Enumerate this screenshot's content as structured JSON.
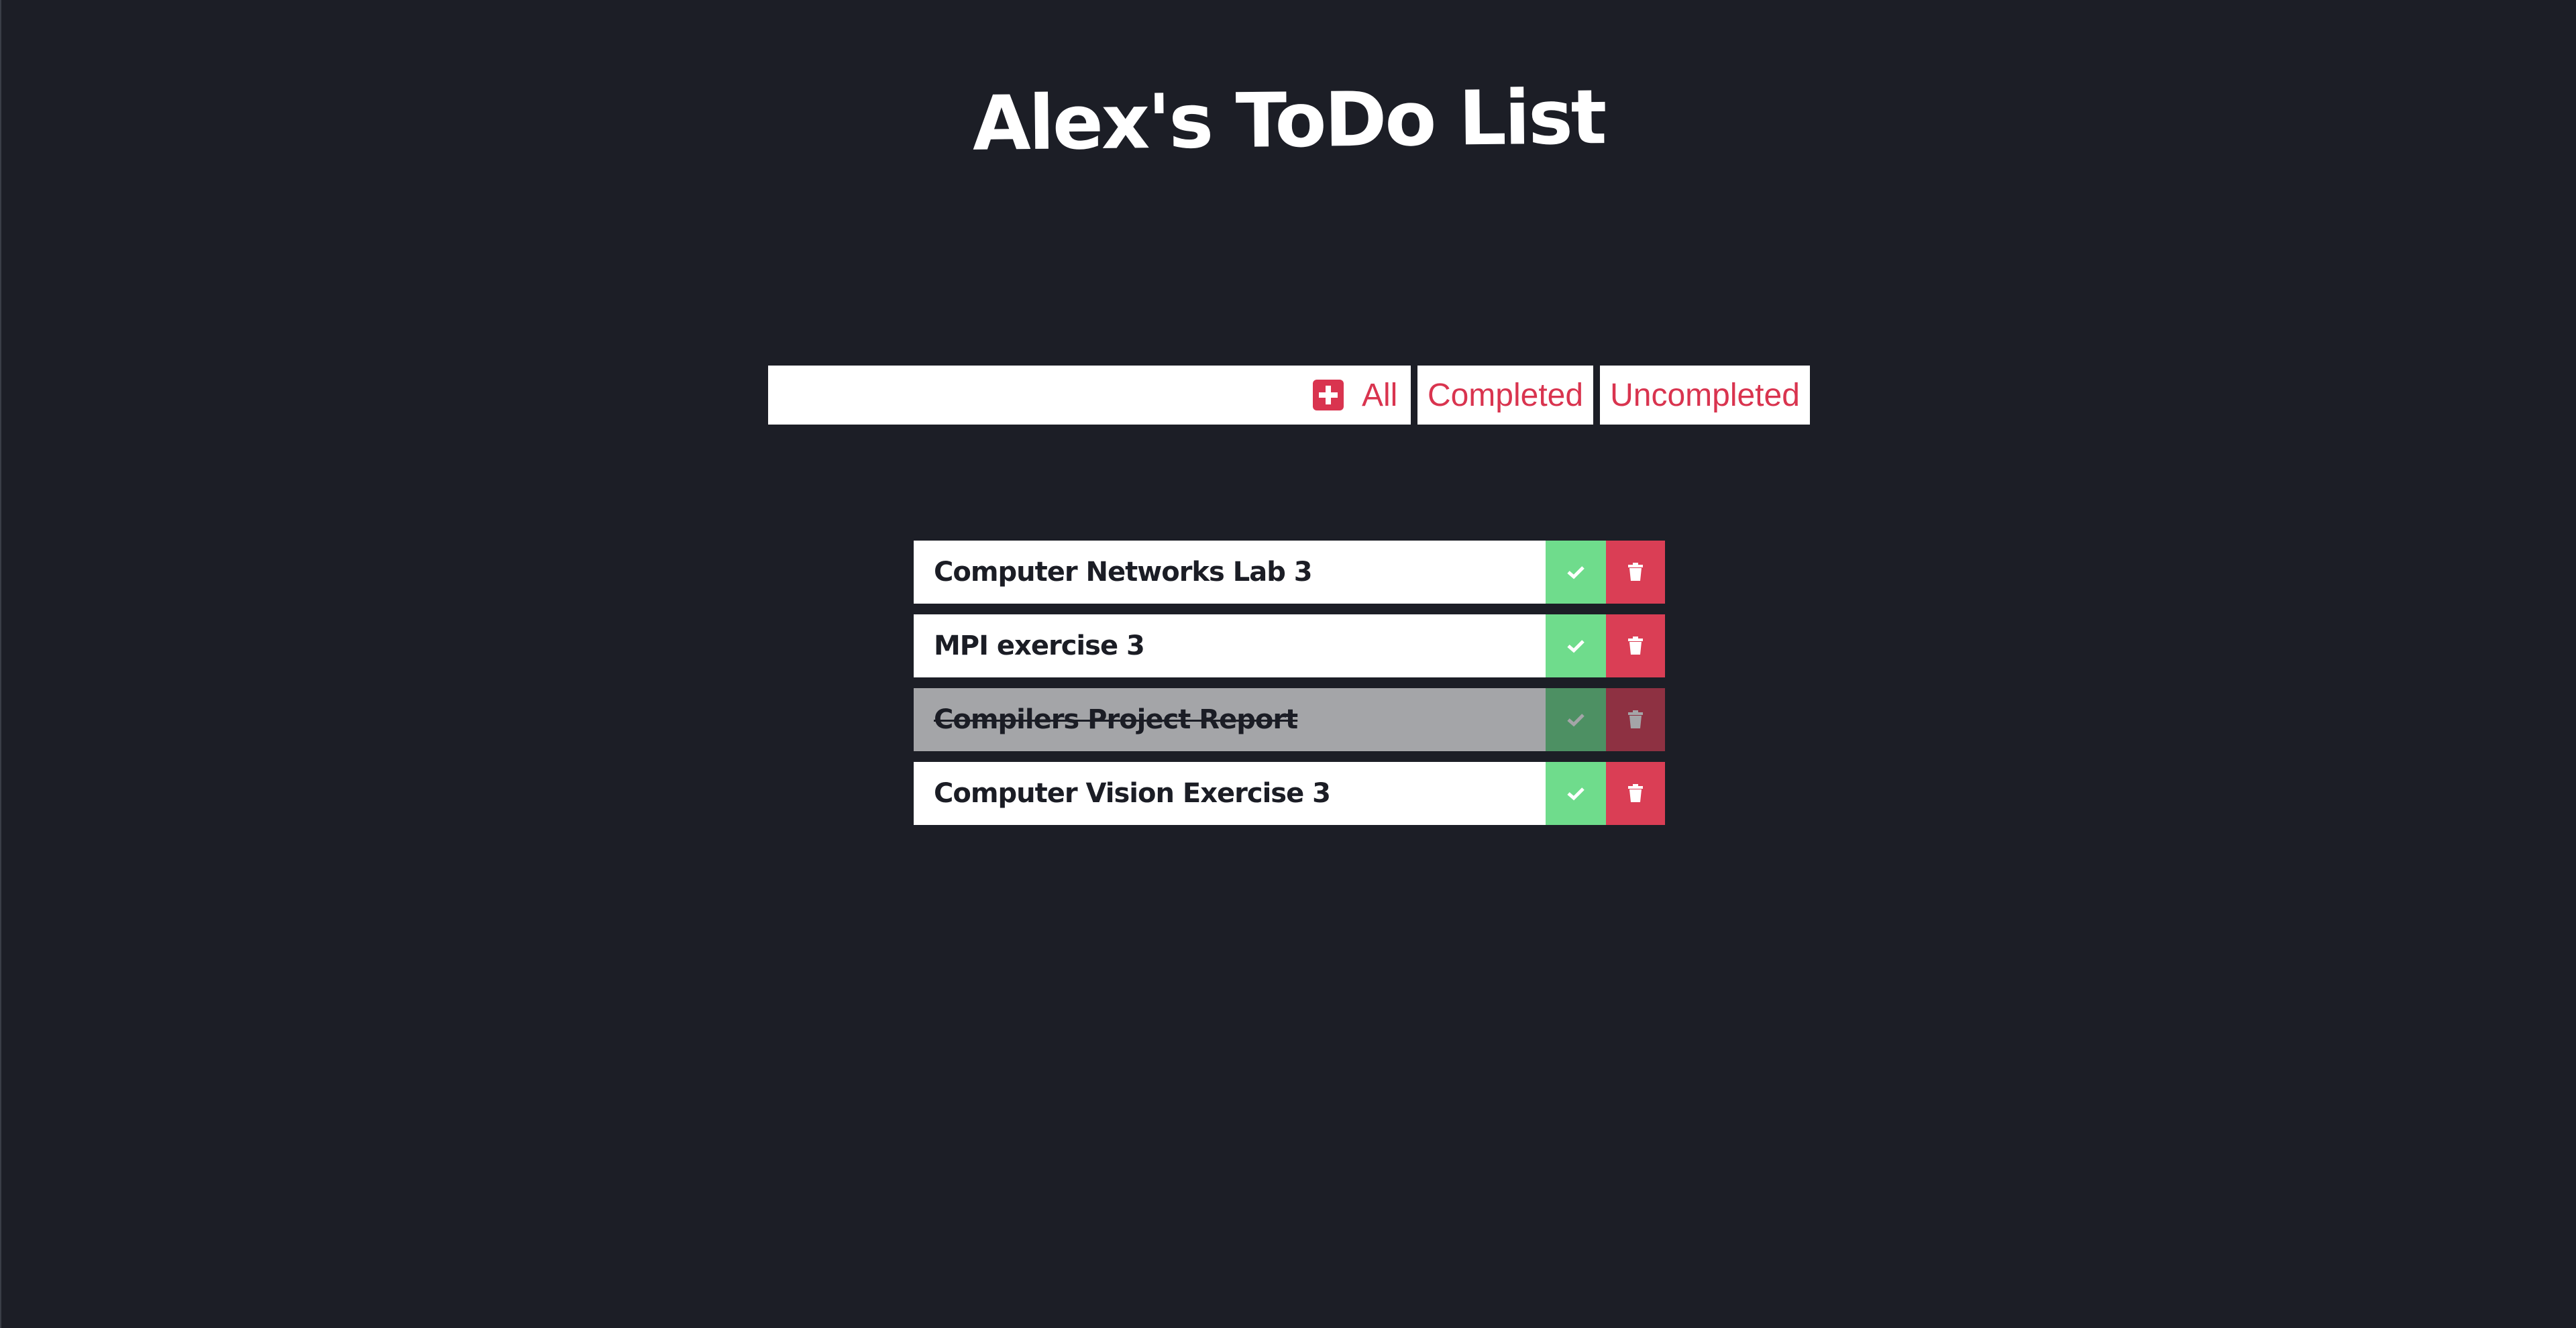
{
  "title": "Alex's ToDo List",
  "input": {
    "value": "",
    "placeholder": ""
  },
  "add_button": {
    "icon": "plus-square-icon"
  },
  "filters": [
    {
      "label": "All",
      "selected": true
    },
    {
      "label": "Completed",
      "selected": false
    },
    {
      "label": "Uncompleted",
      "selected": false
    }
  ],
  "todos": [
    {
      "text": "Computer Networks Lab 3",
      "completed": false
    },
    {
      "text": "MPI exercise 3",
      "completed": false
    },
    {
      "text": "Compilers Project Report",
      "completed": true
    },
    {
      "text": "Computer Vision Exercise 3",
      "completed": false
    }
  ],
  "colors": {
    "background": "#1c1e26",
    "accent": "#d9344f",
    "check": "#6fdc8c",
    "trash": "#da3e55"
  }
}
